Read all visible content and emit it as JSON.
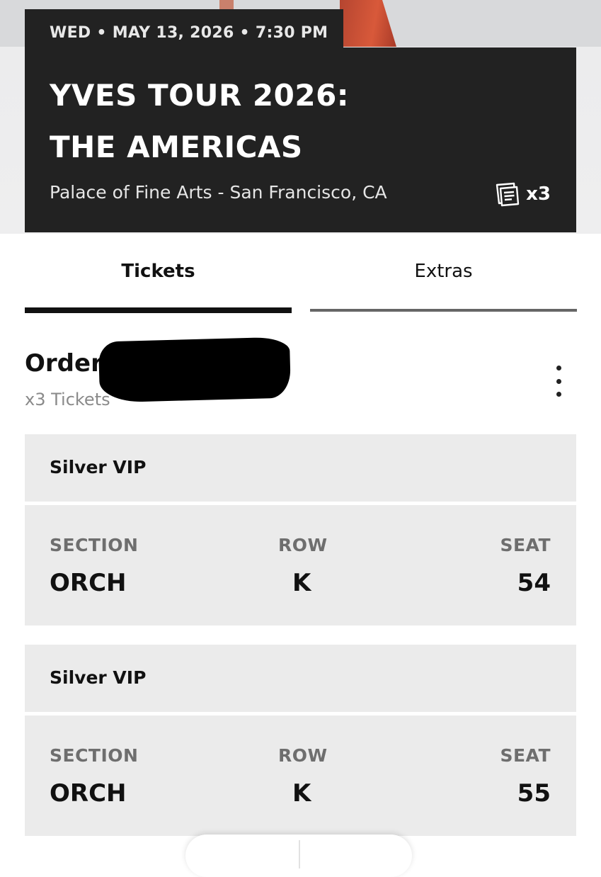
{
  "event": {
    "date_line": "WED • MAY 13, 2026 • 7:30 PM",
    "title_line1": "YVES TOUR 2026:",
    "title_line2": "THE AMERICAS",
    "venue": "Palace of Fine Arts - San Francisco, CA",
    "ticket_count": "x3",
    "ticket_icon": "tickets-icon"
  },
  "tabs": [
    {
      "label": "Tickets",
      "active": true
    },
    {
      "label": "Extras",
      "active": false
    }
  ],
  "order": {
    "title": "Order",
    "subtitle": "x3 Tickets",
    "menu_icon": "more-vertical-icon"
  },
  "tickets": [
    {
      "tier": "Silver VIP",
      "section_label": "SECTION",
      "section": "ORCH",
      "row_label": "ROW",
      "row": "K",
      "seat_label": "SEAT",
      "seat": "54"
    },
    {
      "tier": "Silver VIP",
      "section_label": "SECTION",
      "section": "ORCH",
      "row_label": "ROW",
      "row": "K",
      "seat_label": "SEAT",
      "seat": "55"
    }
  ],
  "colors": {
    "card_dark": "#222222",
    "tile_gray": "#ebebeb",
    "label_gray": "#6e6e6e"
  }
}
